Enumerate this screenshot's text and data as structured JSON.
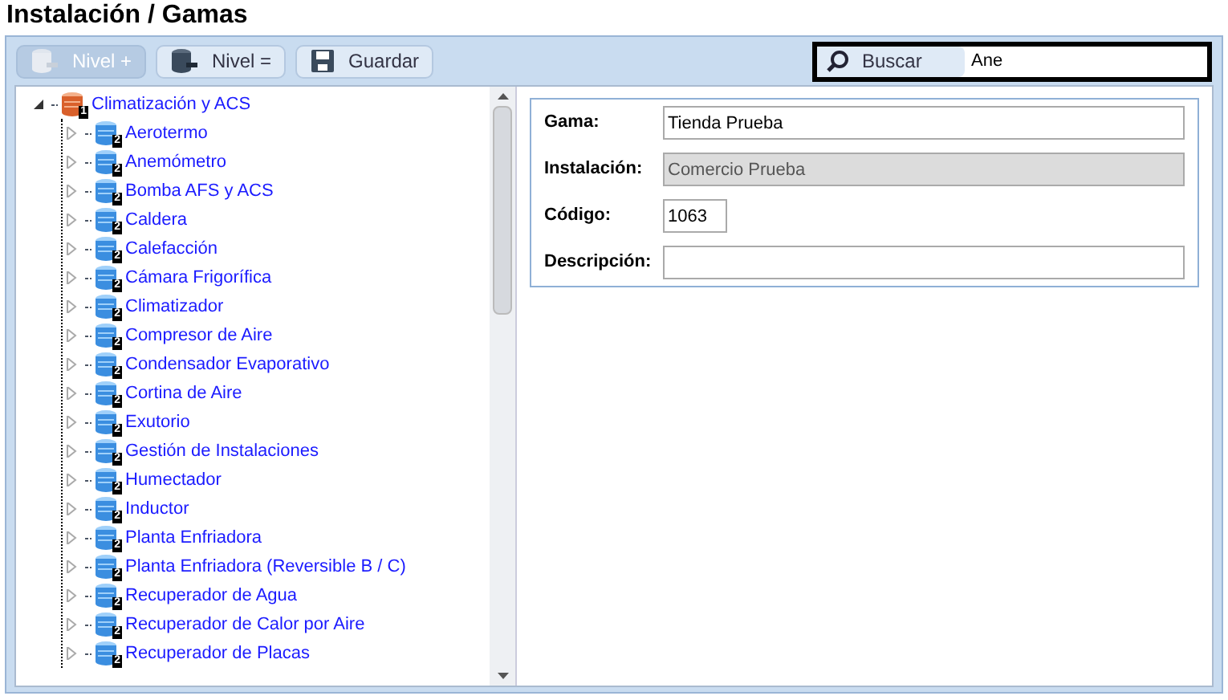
{
  "title": "Instalación / Gamas",
  "toolbar": [
    {
      "label": "Nivel +",
      "kind": "add",
      "disabled": true
    },
    {
      "label": "Nivel =",
      "kind": "same",
      "disabled": false
    },
    {
      "label": "Guardar",
      "kind": "save",
      "disabled": false
    }
  ],
  "search": {
    "button": "Buscar",
    "value": "Ane"
  },
  "tree": [
    {
      "label": "Climatización y ACS",
      "badge": "1",
      "expanded": true,
      "children": [
        {
          "label": "Aerotermo",
          "badge": "2",
          "expanded": false
        },
        {
          "label": "Anemómetro",
          "badge": "2",
          "expanded": false
        },
        {
          "label": "Bomba AFS y ACS",
          "badge": "2",
          "expanded": false
        },
        {
          "label": "Caldera",
          "badge": "2",
          "expanded": false
        },
        {
          "label": "Calefacción",
          "badge": "2",
          "expanded": false
        },
        {
          "label": "Cámara Frigorífica",
          "badge": "2",
          "expanded": false
        },
        {
          "label": "Climatizador",
          "badge": "2",
          "expanded": false
        },
        {
          "label": "Compresor de Aire",
          "badge": "2",
          "expanded": false
        },
        {
          "label": "Condensador Evaporativo",
          "badge": "2",
          "expanded": false
        },
        {
          "label": "Cortina de Aire",
          "badge": "2",
          "expanded": false
        },
        {
          "label": "Exutorio",
          "badge": "2",
          "expanded": false
        },
        {
          "label": "Gestión de Instalaciones",
          "badge": "2",
          "expanded": false
        },
        {
          "label": "Humectador",
          "badge": "2",
          "expanded": false
        },
        {
          "label": "Inductor",
          "badge": "2",
          "expanded": false
        },
        {
          "label": "Planta Enfriadora",
          "badge": "2",
          "expanded": false
        },
        {
          "label": "Planta Enfriadora (Reversible B / C)",
          "badge": "2",
          "expanded": false
        },
        {
          "label": "Recuperador de Agua",
          "badge": "2",
          "expanded": false
        },
        {
          "label": "Recuperador de Calor por Aire",
          "badge": "2",
          "expanded": false
        },
        {
          "label": "Recuperador de Placas",
          "badge": "2",
          "expanded": false
        }
      ]
    }
  ],
  "form": [
    {
      "label": "Gama:",
      "value": "Tienda Prueba",
      "disabled": false,
      "kind": "wide"
    },
    {
      "label": "Instalación:",
      "value": "Comercio Prueba",
      "disabled": true,
      "kind": "wide"
    },
    {
      "label": "Código:",
      "value": "1063",
      "disabled": false,
      "kind": "short"
    },
    {
      "label": "Descripción:",
      "disabled": false,
      "kind": "wide"
    }
  ]
}
